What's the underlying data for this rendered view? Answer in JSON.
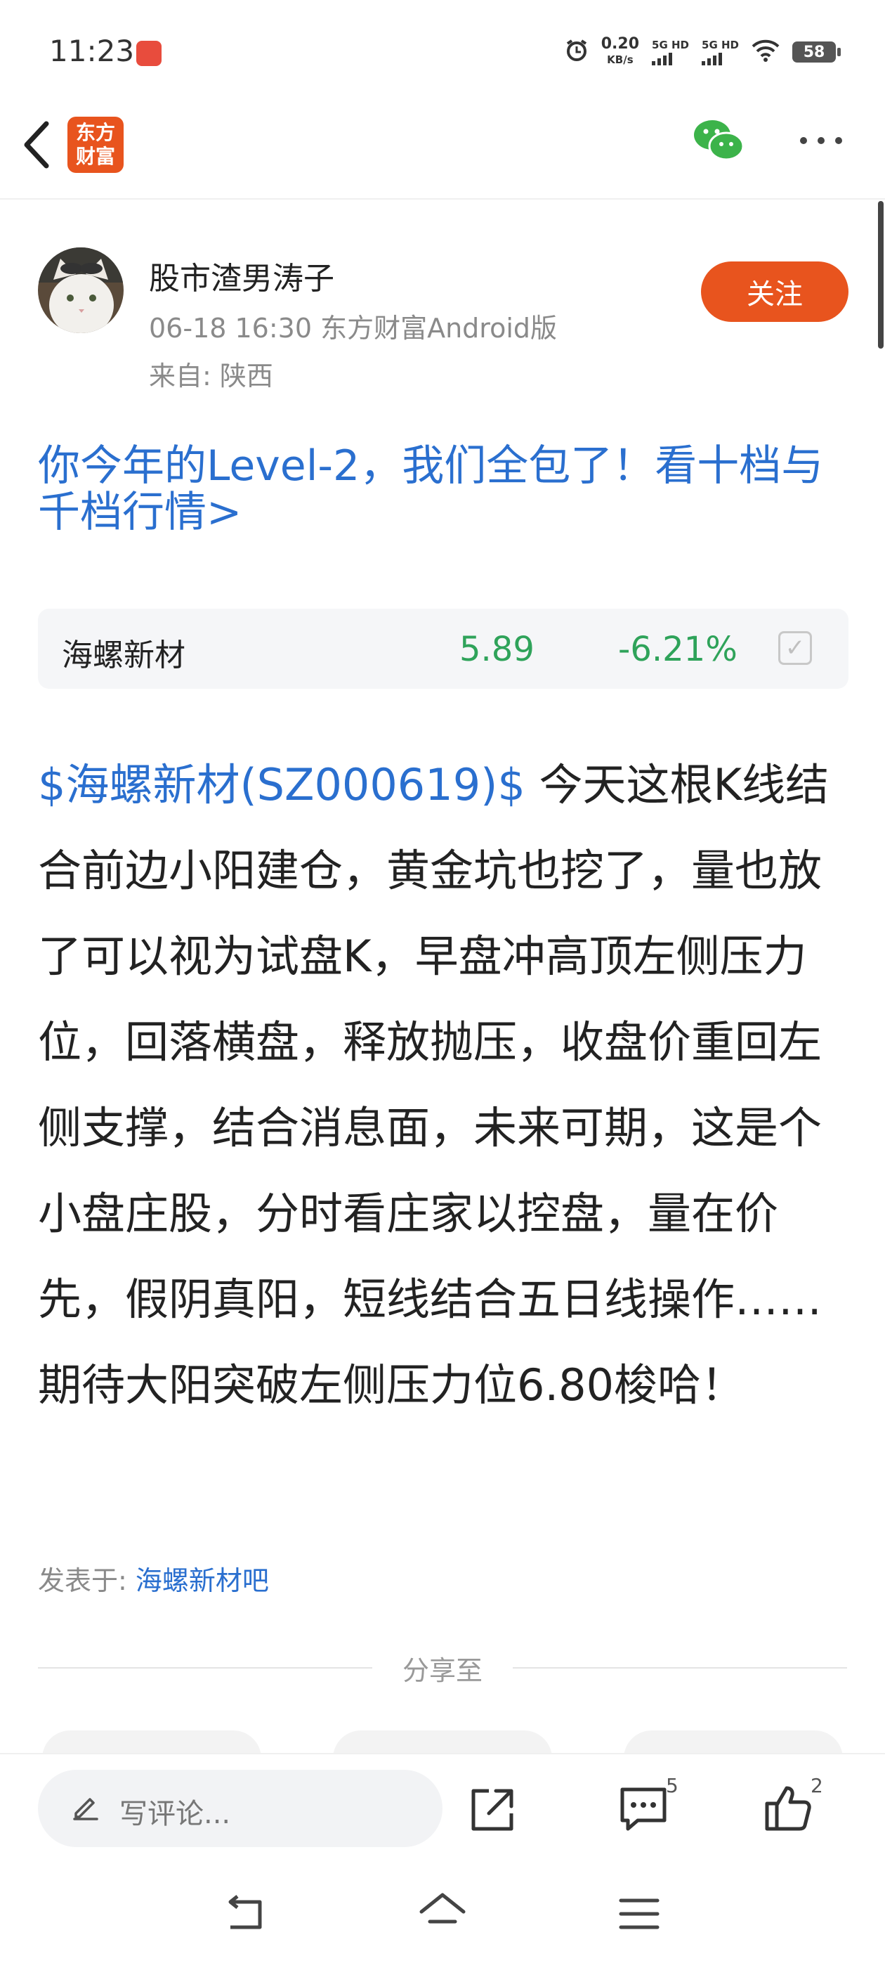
{
  "status_bar": {
    "time": "11:23",
    "net_speed_value": "0.20",
    "net_speed_unit": "KB/s",
    "signal_1": "5G HD",
    "signal_2": "5G HD",
    "battery": "58"
  },
  "header": {
    "logo_line1": "东方",
    "logo_line2": "财富"
  },
  "author": {
    "name": "股市渣男涛子",
    "meta": "06-18 16:30 东方财富Android版",
    "from": "来自: 陕西",
    "follow_label": "关注"
  },
  "promo": {
    "text": "你今年的Level-2，我们全包了！看十档与千档行情>"
  },
  "stock": {
    "name": "海螺新材",
    "price": "5.89",
    "change": "-6.21%"
  },
  "post": {
    "stock_link": "$海螺新材(SZ000619)$",
    "body": " 今天这根K线结合前边小阳建仓，黄金坑也挖了，量也放了可以视为试盘K，早盘冲高顶左侧压力位，回落横盘，释放抛压，收盘价重回左侧支撑，结合消息面，未来可期，这是个小盘庄股，分时看庄家以控盘，量在价先，假阴真阳，短线结合五日线操作……期待大阳突破左侧压力位6.80梭哈！",
    "posted_in_label": "发表于: ",
    "posted_in_link": "海螺新材吧"
  },
  "share": {
    "label": "分享至"
  },
  "bottom_bar": {
    "comment_placeholder": "写评论...",
    "comment_count": "5",
    "like_count": "2"
  },
  "colors": {
    "brand": "#e8541e",
    "link": "#2a6fcf",
    "down": "#2fa35a"
  }
}
